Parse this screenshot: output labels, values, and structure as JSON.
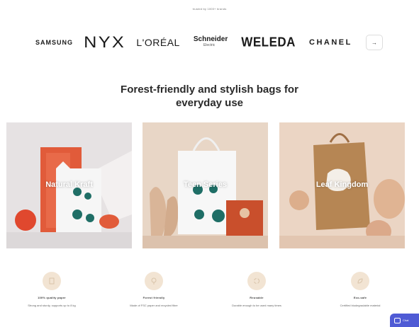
{
  "top_note": "trusted by 1000+ brands",
  "logos": {
    "samsung": "SAMSUNG",
    "nyx": "NYX",
    "loreal": "L'ORÉAL",
    "schneider_line1": "Schneider",
    "schneider_line2": "Electric",
    "weleda": "WELEDA",
    "chanel": "CHANEL",
    "next_label": "→"
  },
  "headline": {
    "line1": "Forest-friendly and stylish bags for",
    "line2": "everyday use"
  },
  "cards": [
    {
      "label": "Natural Kraft"
    },
    {
      "label": "Teen Series"
    },
    {
      "label": "Leaf Kingdom"
    }
  ],
  "features": [
    {
      "title": "100% quality paper",
      "text": "Strong and sturdy, supports up to 8 kg",
      "icon": "paper-icon"
    },
    {
      "title": "Forest friendly",
      "text": "Made of FSC paper and recycled fiber",
      "icon": "tree-icon"
    },
    {
      "title": "Reusable",
      "text": "Durable enough to be used many times",
      "icon": "recycle-icon"
    },
    {
      "title": "Eco-safe",
      "text": "Certified biodegradable material",
      "icon": "leaf-icon"
    }
  ],
  "chat": {
    "label": "Chat"
  },
  "colors": {
    "accent": "#4f5bd5",
    "feature_icon_bg": "#f2e4d3",
    "card_1_bg": "#e7e3e3",
    "card_2_bg": "#e9d8c9",
    "card_3_bg": "#ead4c3"
  }
}
